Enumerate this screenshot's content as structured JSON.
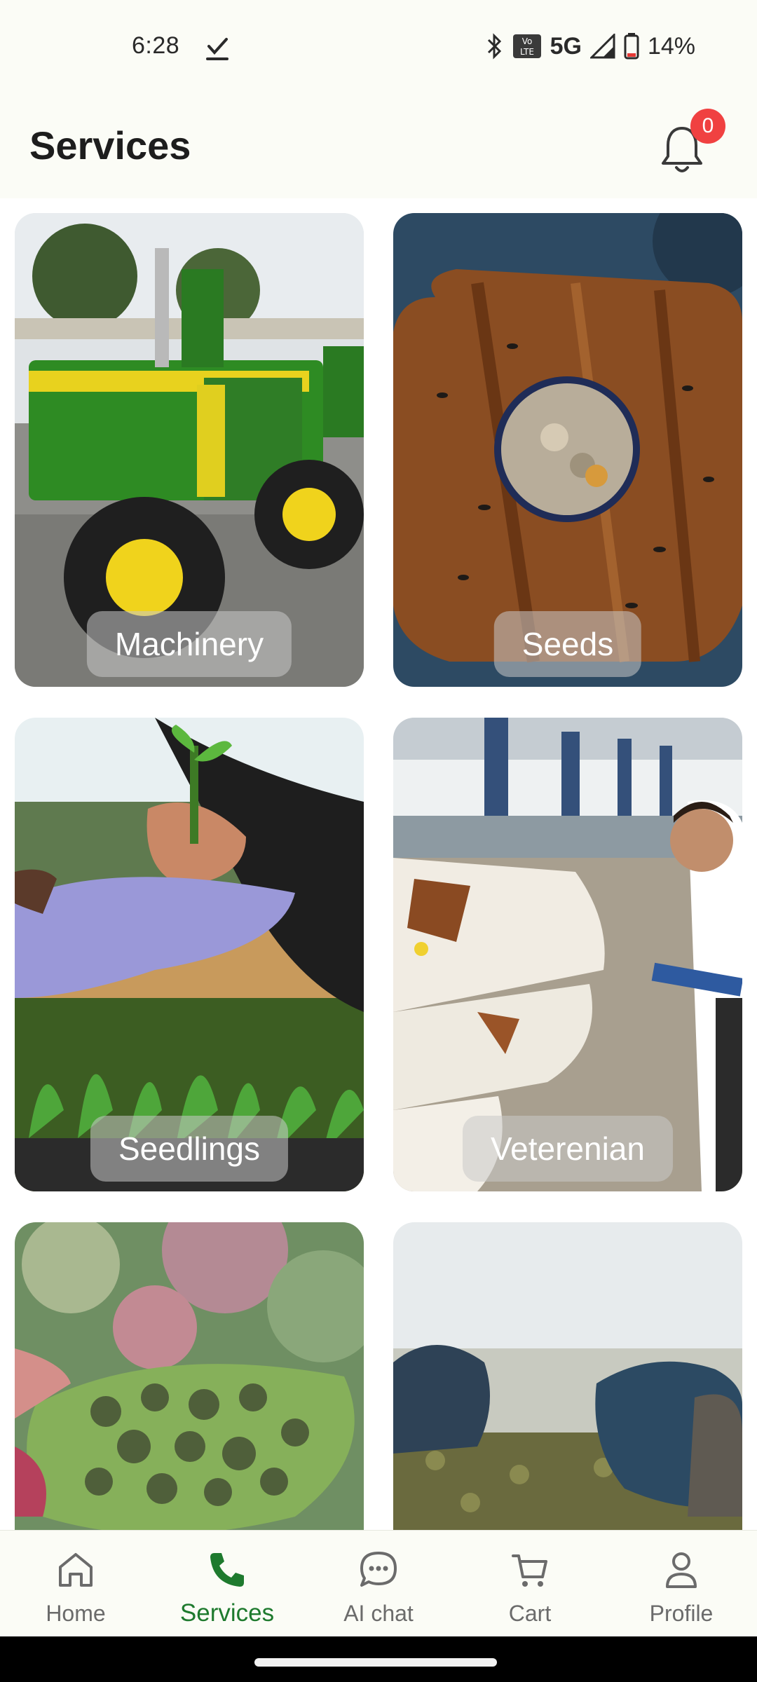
{
  "status_bar": {
    "time": "6:28",
    "network": "5G",
    "battery": "14%"
  },
  "header": {
    "title": "Services",
    "notification_count": "0"
  },
  "services": [
    {
      "label": "Machinery"
    },
    {
      "label": "Seeds"
    },
    {
      "label": "Seedlings"
    },
    {
      "label": "Veterenian"
    }
  ],
  "bottom_nav": {
    "items": [
      {
        "label": "Home",
        "icon": "home-icon"
      },
      {
        "label": "Services",
        "icon": "phone-icon",
        "active": true
      },
      {
        "label": "AI chat",
        "icon": "chat-icon"
      },
      {
        "label": "Cart",
        "icon": "cart-icon"
      },
      {
        "label": "Profile",
        "icon": "profile-icon"
      }
    ]
  },
  "colors": {
    "accent": "#1e7a2e",
    "badge": "#f04141",
    "background": "#fbfcf6"
  }
}
